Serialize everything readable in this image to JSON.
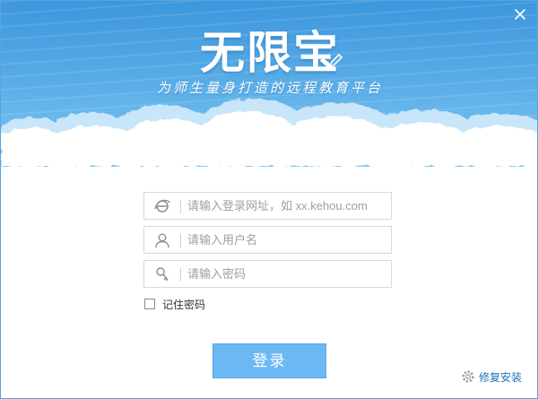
{
  "window": {
    "close_symbol": "×"
  },
  "header": {
    "logo_text": "无限宝",
    "slogan": "为师生量身打造的远程教育平台"
  },
  "form": {
    "url_placeholder": "请输入登录网址，如 xx.kehou.com",
    "url_value": "",
    "username_placeholder": "请输入用户名",
    "username_value": "",
    "password_placeholder": "请输入密码",
    "password_value": "",
    "remember_label": "记住密码",
    "remember_checked": false,
    "login_label": "登录"
  },
  "footer": {
    "repair_label": "修复安装"
  },
  "icons": {
    "url_field": "ie-icon",
    "username_field": "user-icon",
    "password_field": "key-icon",
    "repair": "gear-icon",
    "close": "close-icon"
  },
  "colors": {
    "banner_top": "#3d97dd",
    "banner_bottom": "#85c9f2",
    "login_button": "#6cb8f3",
    "link": "#1f6fbf",
    "window_border": "#5aa3de"
  }
}
